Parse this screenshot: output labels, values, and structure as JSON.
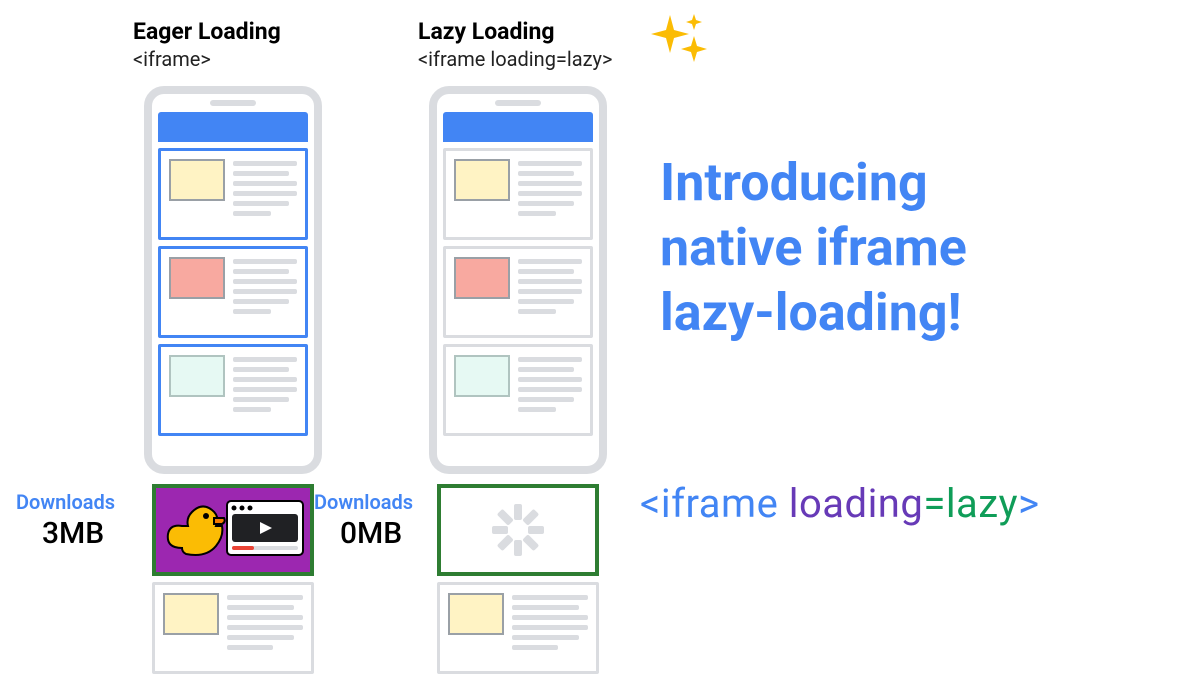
{
  "columns": {
    "eager": {
      "title": "Eager Loading",
      "code": "<iframe>",
      "download_label": "Downloads",
      "download_value": "3MB"
    },
    "lazy": {
      "title": "Lazy Loading",
      "code": "<iframe loading=lazy>",
      "download_label": "Downloads",
      "download_value": "0MB"
    }
  },
  "headline": {
    "line1": "Introducing",
    "line2": "native iframe",
    "line3": "lazy-loading!"
  },
  "snippet": {
    "lt": "<",
    "tag": "iframe",
    "space": " ",
    "attr": "loading",
    "eq": "=",
    "val": "lazy",
    "gt": ">"
  },
  "icons": {
    "sparkle": "sparkle-icon",
    "duck": "duck-icon",
    "video": "video-player-icon",
    "spinner": "loading-spinner-icon"
  }
}
